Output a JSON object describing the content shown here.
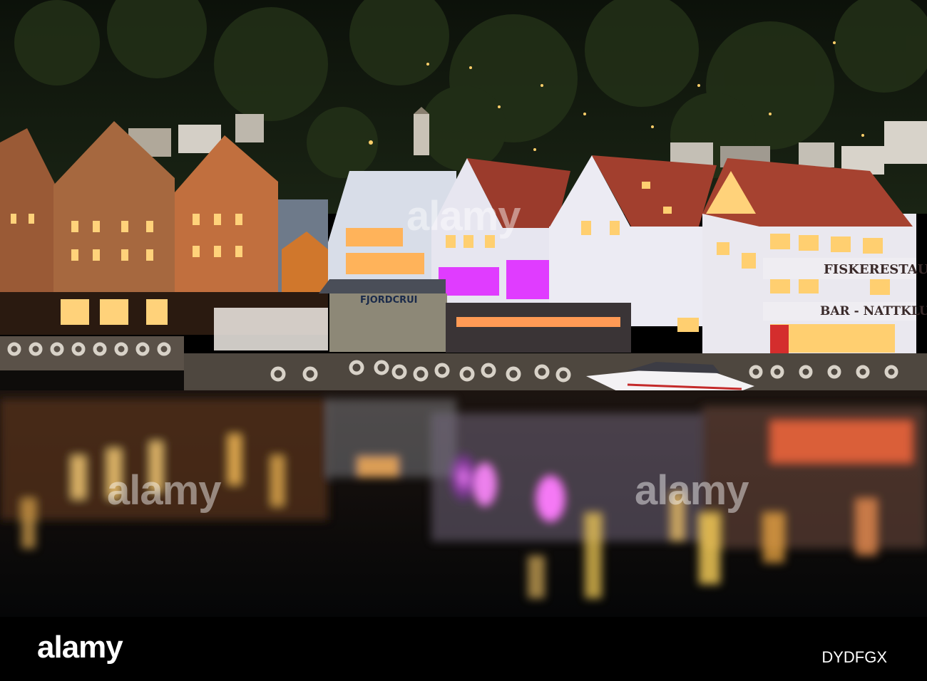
{
  "scene": {
    "signs": {
      "restaurant": "FISKERESTAURANT",
      "bar": "BAR - NATTKLUBB",
      "kiosk": "FJORDCRUI"
    }
  },
  "watermark": {
    "center": "alamy",
    "left": "alamy",
    "right": "alamy"
  },
  "footer": {
    "logo": "alamy",
    "image_code": "DYDFGX"
  },
  "colors": {
    "sky_hill": "#12170d",
    "water": "#080a0c",
    "accent_magenta": "#e03cff",
    "accent_amber": "#ffb347"
  }
}
